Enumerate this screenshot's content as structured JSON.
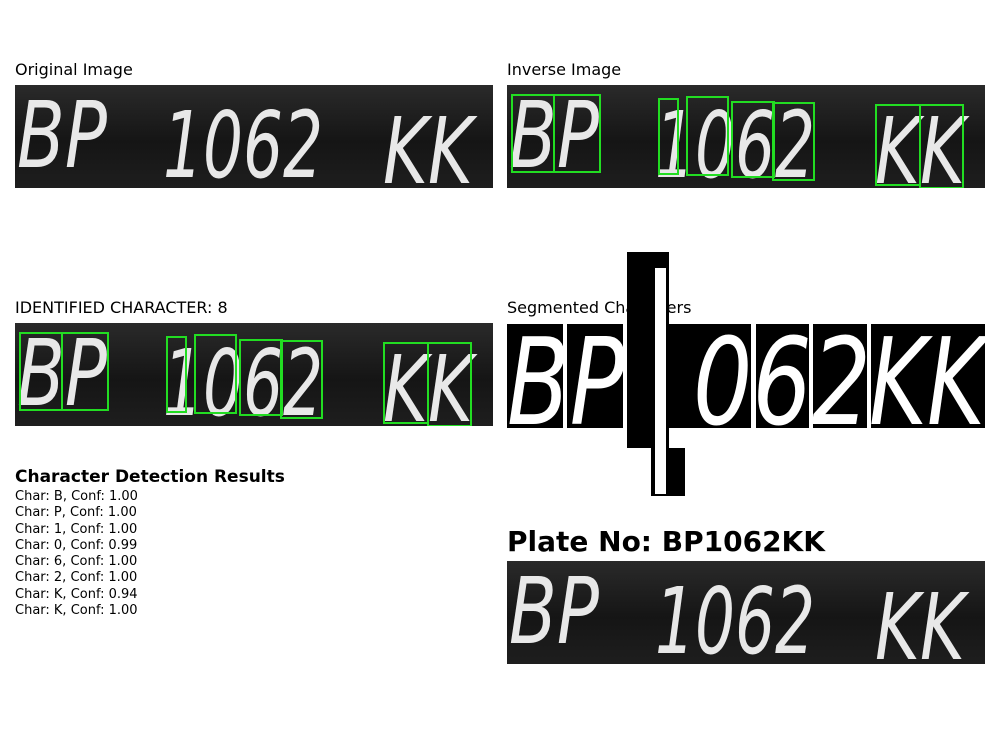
{
  "panels": {
    "original": {
      "title": "Original Image"
    },
    "inverse": {
      "title": "Inverse Image"
    },
    "identified": {
      "title": "IDENTIFIED CHARACTER: 8"
    },
    "segmented": {
      "title": "Segmented Characters"
    }
  },
  "plate": {
    "characters": [
      "B",
      "P",
      "1",
      "0",
      "6",
      "2",
      "K",
      "K"
    ]
  },
  "detection": {
    "title": "Character Detection Results",
    "results": [
      "Char: B, Conf: 1.00",
      "Char: P, Conf: 1.00",
      "Char: 1, Conf: 1.00",
      "Char: 0, Conf: 0.99",
      "Char: 6, Conf: 1.00",
      "Char: 2, Conf: 1.00",
      "Char: K, Conf: 0.94",
      "Char: K, Conf: 1.00"
    ]
  },
  "plate_number": {
    "label": "Plate No: BP1062KK"
  },
  "colors": {
    "box": "#22dd22",
    "plate_bg": "#1a1a1a",
    "plate_text": "#e8e8e8"
  }
}
